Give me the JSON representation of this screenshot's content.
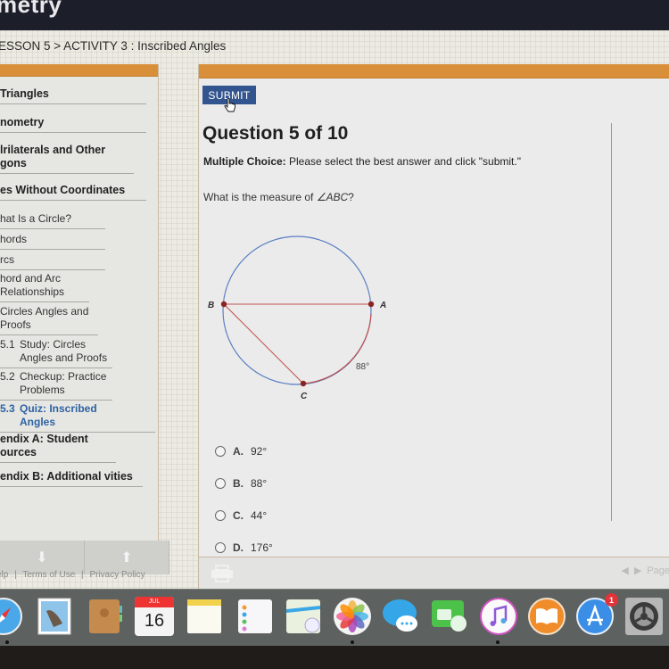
{
  "app": {
    "title": "metry"
  },
  "breadcrumb": "ESSON 5 > ACTIVITY 3 : Inscribed Angles",
  "sidebar": {
    "units": [
      {
        "label": "Triangles"
      },
      {
        "label": "nometry"
      },
      {
        "label": "lrilaterals and Other gons"
      },
      {
        "label": "es Without Coordinates"
      }
    ],
    "lessons": [
      {
        "label": "hat Is a Circle?"
      },
      {
        "label": "hords"
      },
      {
        "label": "rcs"
      },
      {
        "label": "hord and Arc Relationships"
      },
      {
        "label": "Circles Angles and Proofs"
      }
    ],
    "activities": [
      {
        "num": "5.1",
        "label": "Study: Circles Angles and Proofs",
        "active": false
      },
      {
        "num": "5.2",
        "label": "Checkup: Practice Problems",
        "active": false
      },
      {
        "num": "5.3",
        "label": "Quiz: Inscribed Angles",
        "active": true
      }
    ],
    "appendices": [
      {
        "label": "endix A: Student ources"
      },
      {
        "label": "endix B: Additional vities"
      }
    ],
    "pager": {
      "down_icon": "arrow-down-icon",
      "up_icon": "arrow-up-icon"
    }
  },
  "footer": {
    "links": [
      "elp",
      "|",
      "Terms of Use",
      "|",
      "Privacy Policy"
    ]
  },
  "question": {
    "submit_label": "SUBMIT",
    "title": "Question 5 of 10",
    "instruction_bold": "Multiple Choice:",
    "instruction_rest": " Please select the best answer and click \"submit.\"",
    "prompt_prefix": "What is the measure of ",
    "prompt_angle": "∠ABC",
    "prompt_suffix": "?",
    "diagram": {
      "points": {
        "A": "A",
        "B": "B",
        "C": "C"
      },
      "arc_label": "88°",
      "colors": {
        "circle": "#5b7fc4",
        "chord": "#c0504d",
        "point": "#8b2323"
      }
    },
    "choices": [
      {
        "letter": "A.",
        "value": "92°"
      },
      {
        "letter": "B.",
        "value": "88°"
      },
      {
        "letter": "C.",
        "value": "44°"
      },
      {
        "letter": "D.",
        "value": "176°"
      }
    ]
  },
  "content_footer": {
    "page_label": "Page"
  },
  "dock": {
    "calendar": {
      "month": "JUL",
      "day": "16"
    },
    "app_store_badge": "1",
    "apps": [
      "safari",
      "mail",
      "contacts",
      "calendar",
      "notes",
      "reminders",
      "maps",
      "photos",
      "messages",
      "facetime",
      "itunes",
      "ibooks",
      "app-store",
      "system-preferences"
    ]
  }
}
